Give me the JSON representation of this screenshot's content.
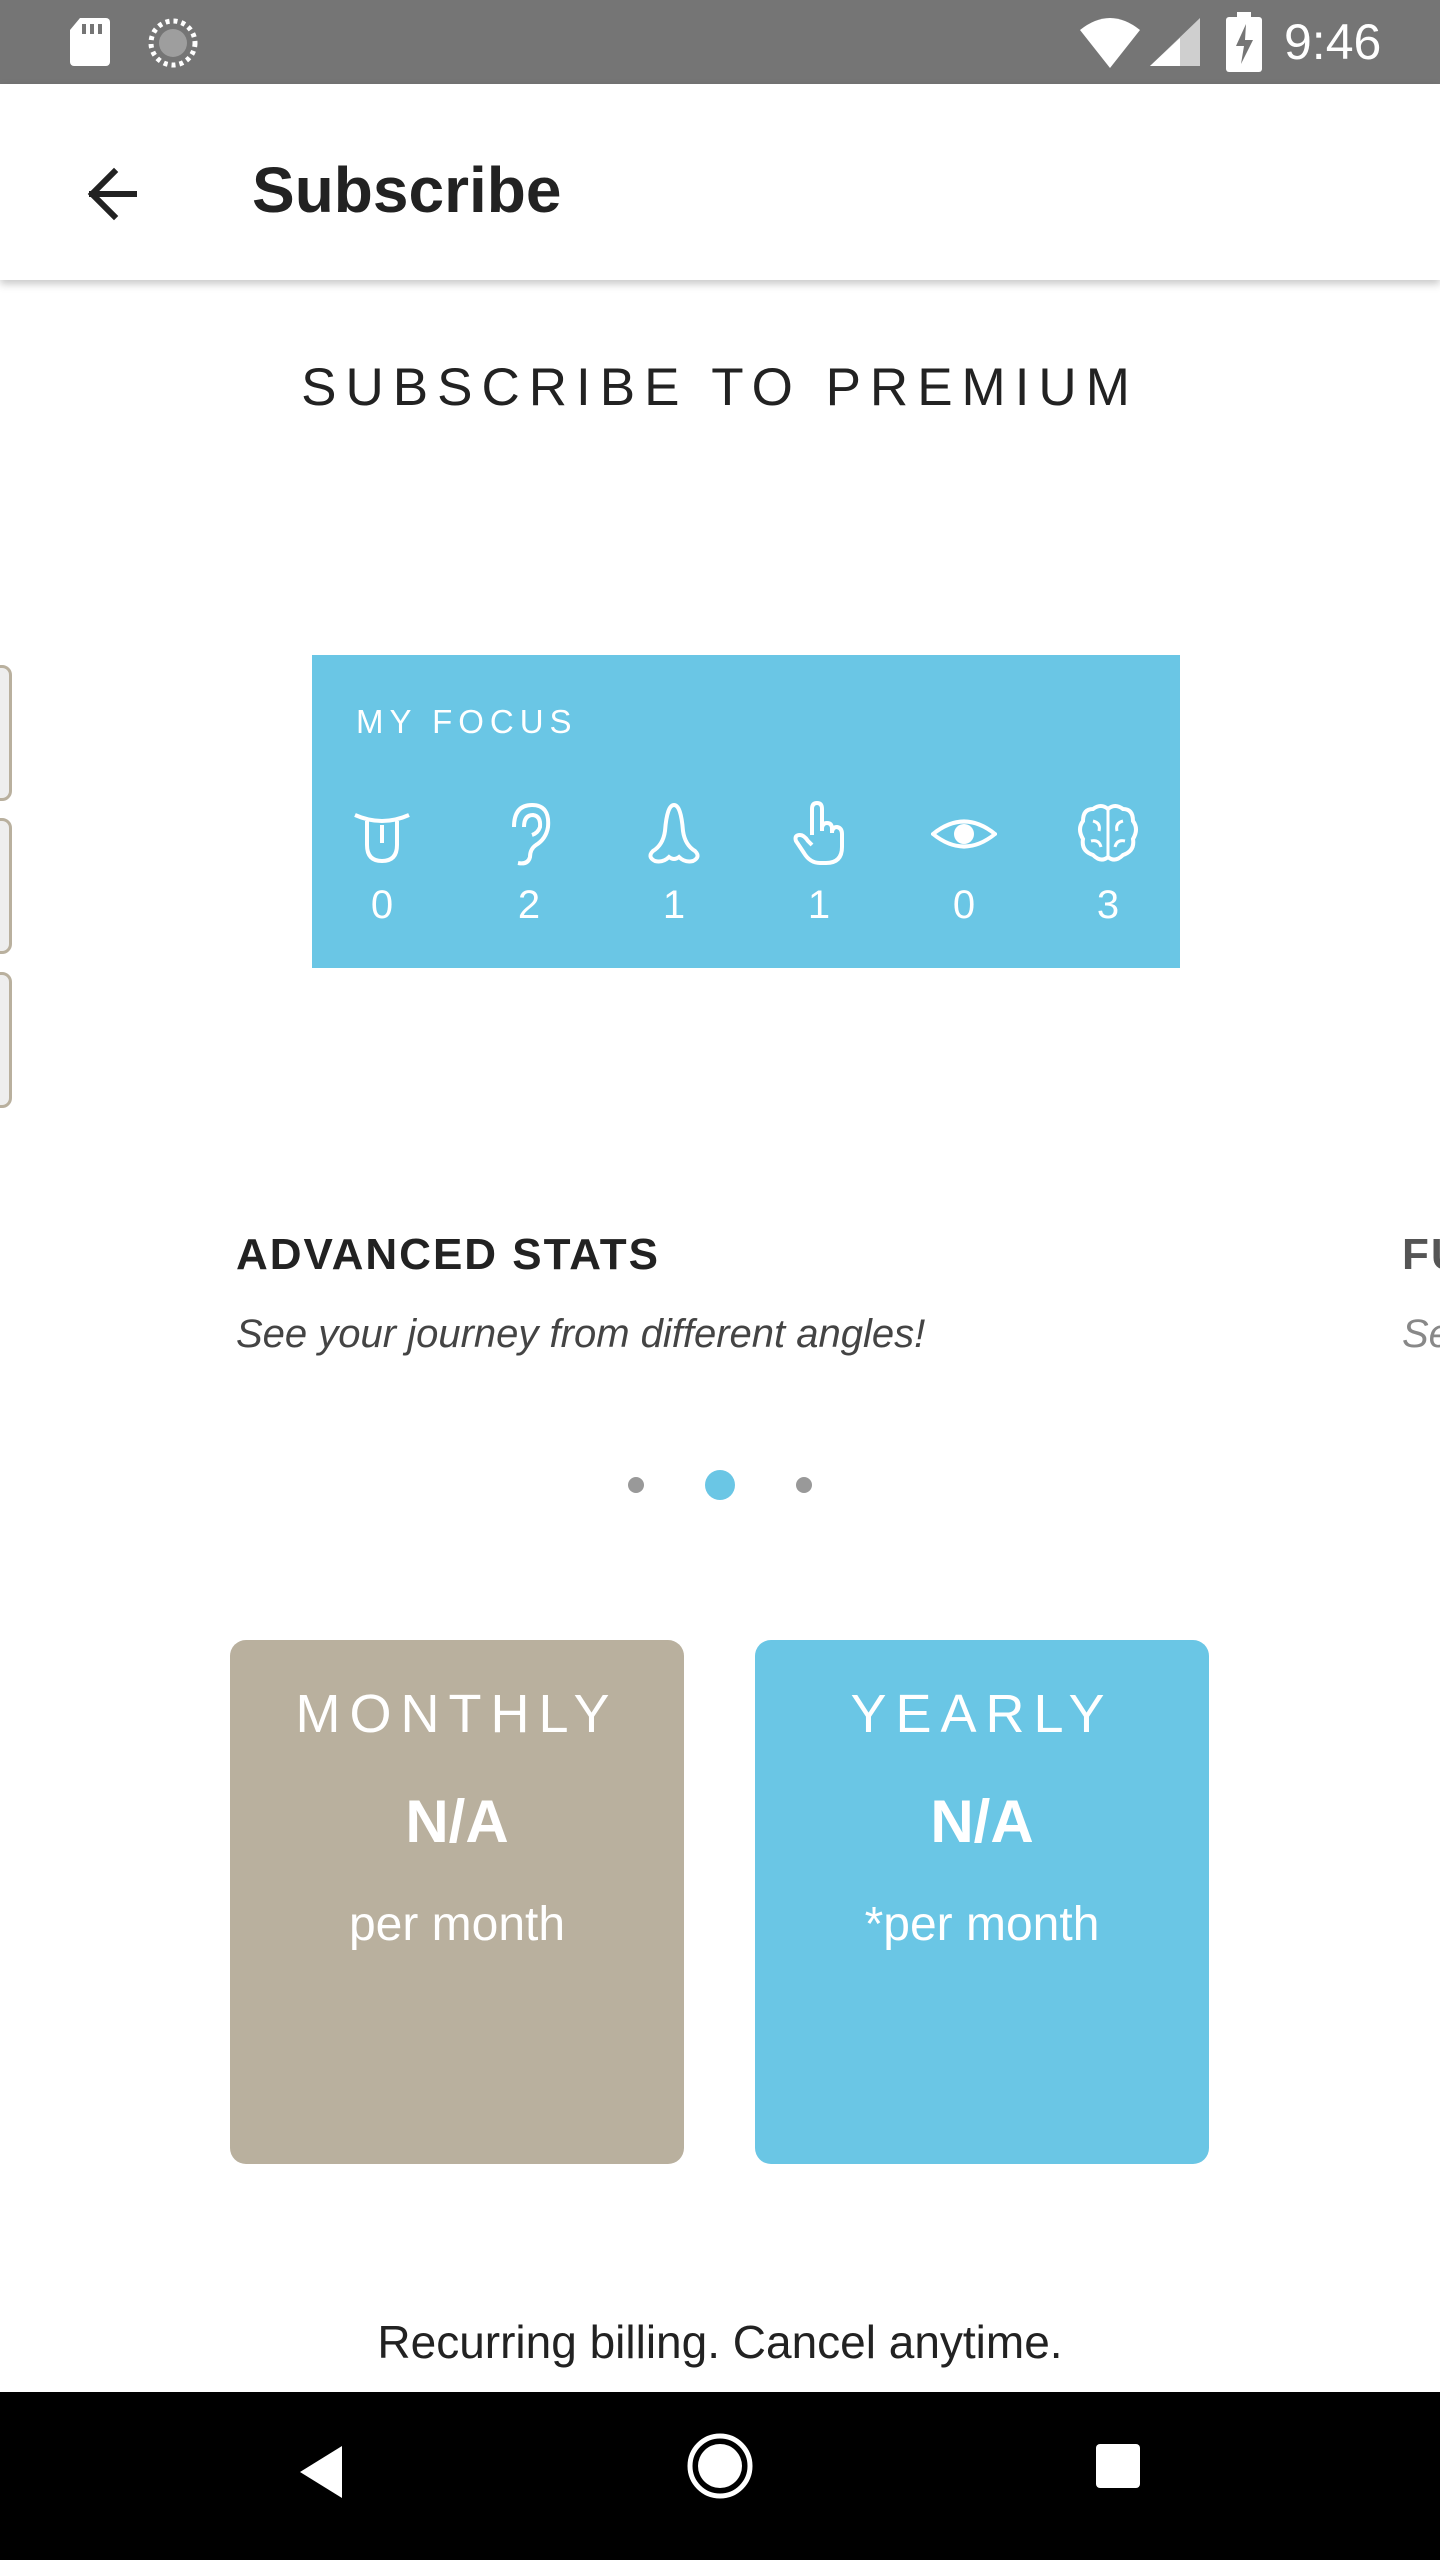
{
  "status_bar": {
    "time": "9:46",
    "icons": [
      "sd-card-icon",
      "sync-icon",
      "wifi-icon",
      "signal-icon",
      "battery-charging-icon"
    ]
  },
  "app_bar": {
    "title": "Subscribe",
    "back_icon": "arrow-back-icon"
  },
  "headline": "SUBSCRIBE TO PREMIUM",
  "focus_card": {
    "title": "MY FOCUS",
    "senses": [
      {
        "icon": "tongue-icon",
        "count": "0"
      },
      {
        "icon": "ear-icon",
        "count": "2"
      },
      {
        "icon": "nose-icon",
        "count": "1"
      },
      {
        "icon": "hand-pointer-icon",
        "count": "1"
      },
      {
        "icon": "eye-icon",
        "count": "0"
      },
      {
        "icon": "brain-icon",
        "count": "3"
      }
    ]
  },
  "feature": {
    "title": "ADVANCED STATS",
    "subtitle": "See your journey from different angles!"
  },
  "feature_next": {
    "title": "FU",
    "subtitle": "Se"
  },
  "pager": {
    "count": 3,
    "active_index": 1
  },
  "plans": {
    "monthly": {
      "name": "MONTHLY",
      "price": "N/A",
      "unit": "per month"
    },
    "yearly": {
      "name": "YEARLY",
      "price": "N/A",
      "unit": "*per month"
    }
  },
  "billing_note": "Recurring billing. Cancel anytime.",
  "colors": {
    "accent_blue": "#6ac6e5",
    "monthly_beige": "#b9b09e",
    "status_bar": "#757575"
  },
  "nav_bar": {
    "icons": [
      "nav-back-icon",
      "nav-home-icon",
      "nav-recents-icon"
    ]
  }
}
